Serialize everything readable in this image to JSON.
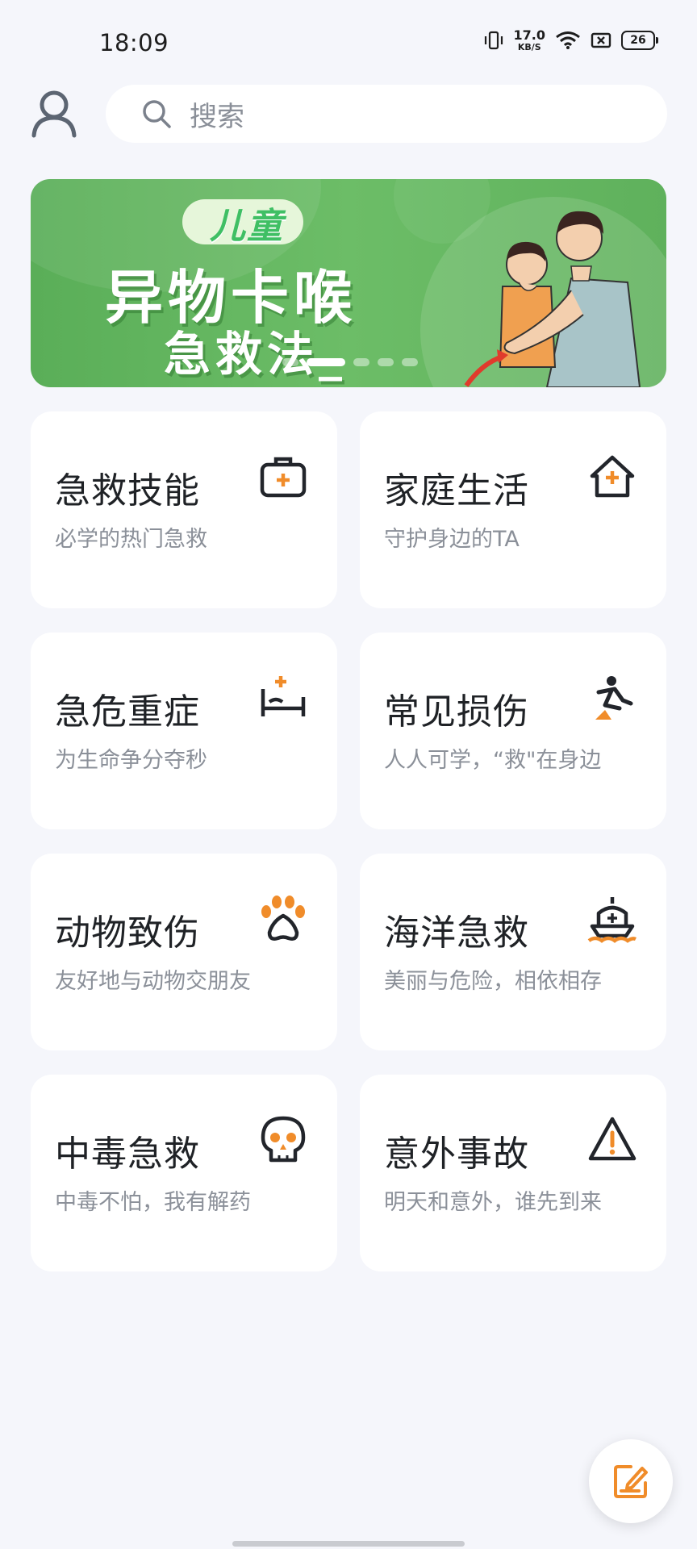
{
  "status_bar": {
    "time": "18:09",
    "net_speed_value": "17.0",
    "net_speed_unit": "KB/S",
    "battery": "26"
  },
  "search": {
    "placeholder": "搜索",
    "icon": "search-icon"
  },
  "profile": {
    "icon": "user-icon"
  },
  "banner": {
    "tag": "儿童",
    "title": "异物卡喉",
    "subtitle": "急救法_",
    "dots": 5,
    "active_dot": 1,
    "bg_color": "#5fb15c"
  },
  "categories": [
    {
      "title": "急救技能",
      "subtitle": "必学的热门急救",
      "icon": "first-aid-kit-icon"
    },
    {
      "title": "家庭生活",
      "subtitle": "守护身边的TA",
      "icon": "house-cross-icon"
    },
    {
      "title": "急危重症",
      "subtitle": "为生命争分夺秒",
      "icon": "hospital-bed-icon"
    },
    {
      "title": "常见损伤",
      "subtitle": "人人可学，“救\"在身边",
      "icon": "falling-person-icon"
    },
    {
      "title": "动物致伤",
      "subtitle": "友好地与动物交朋友",
      "icon": "paw-icon"
    },
    {
      "title": "海洋急救",
      "subtitle": "美丽与危险，相依相存",
      "icon": "ship-icon"
    },
    {
      "title": "中毒急救",
      "subtitle": "中毒不怕，我有解药",
      "icon": "skull-icon"
    },
    {
      "title": "意外事故",
      "subtitle": "明天和意外，谁先到来",
      "icon": "warning-icon"
    }
  ],
  "fab": {
    "icon": "edit-note-icon"
  },
  "colors": {
    "accent": "#f08c2a",
    "icon_dark": "#22252b",
    "background": "#f5f6fb"
  }
}
